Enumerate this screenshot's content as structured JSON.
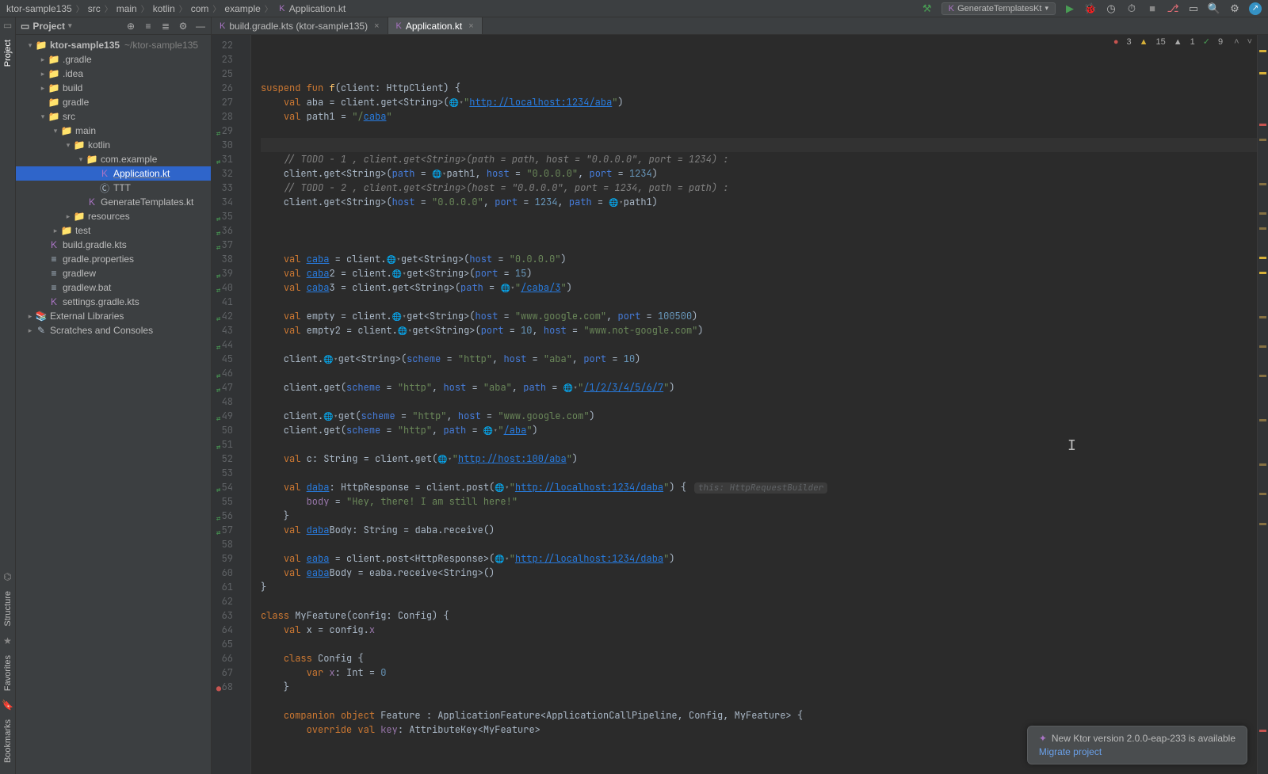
{
  "breadcrumbs": [
    "ktor-sample135",
    "src",
    "main",
    "kotlin",
    "com",
    "example",
    "Application.kt"
  ],
  "run_config": "GenerateTemplatesKt",
  "inspections": {
    "errors": "3",
    "warnings": "15",
    "weak": "1",
    "typos": "9"
  },
  "project_header": {
    "label": "Project"
  },
  "tree": [
    {
      "depth": 0,
      "arrow": "▾",
      "icon": "📁",
      "iconClass": "folder-c",
      "label": "ktor-sample135",
      "suffix": "~/ktor-sample135",
      "bold": true
    },
    {
      "depth": 1,
      "arrow": "▸",
      "icon": "📁",
      "iconClass": "orange-folder",
      "label": ".gradle"
    },
    {
      "depth": 1,
      "arrow": "▸",
      "icon": "📁",
      "iconClass": "orange-folder",
      "label": ".idea"
    },
    {
      "depth": 1,
      "arrow": "▸",
      "icon": "📁",
      "iconClass": "orange-folder",
      "label": "build"
    },
    {
      "depth": 1,
      "arrow": "",
      "icon": "📁",
      "iconClass": "folder-c",
      "label": "gradle"
    },
    {
      "depth": 1,
      "arrow": "▾",
      "icon": "📁",
      "iconClass": "blue-folder",
      "label": "src"
    },
    {
      "depth": 2,
      "arrow": "▾",
      "icon": "📁",
      "iconClass": "blue-folder",
      "label": "main"
    },
    {
      "depth": 3,
      "arrow": "▾",
      "icon": "📁",
      "iconClass": "blue-folder",
      "label": "kotlin"
    },
    {
      "depth": 4,
      "arrow": "▾",
      "icon": "📁",
      "iconClass": "folder-c",
      "label": "com.example"
    },
    {
      "depth": 5,
      "arrow": "",
      "icon": "K",
      "iconClass": "kt-file",
      "label": "Application.kt",
      "selected": true,
      "underline": true
    },
    {
      "depth": 5,
      "arrow": "",
      "icon": "Ⓒ",
      "iconClass": "file-c",
      "label": "TTT"
    },
    {
      "depth": 4,
      "arrow": "",
      "icon": "K",
      "iconClass": "kt-file",
      "label": "GenerateTemplates.kt"
    },
    {
      "depth": 3,
      "arrow": "▸",
      "icon": "📁",
      "iconClass": "folder-c",
      "label": "resources"
    },
    {
      "depth": 2,
      "arrow": "▸",
      "icon": "📁",
      "iconClass": "folder-c",
      "label": "test"
    },
    {
      "depth": 1,
      "arrow": "",
      "icon": "K",
      "iconClass": "kt-file",
      "label": "build.gradle.kts"
    },
    {
      "depth": 1,
      "arrow": "",
      "icon": "≡",
      "iconClass": "file-c",
      "label": "gradle.properties"
    },
    {
      "depth": 1,
      "arrow": "",
      "icon": "≡",
      "iconClass": "file-c",
      "label": "gradlew"
    },
    {
      "depth": 1,
      "arrow": "",
      "icon": "≡",
      "iconClass": "file-c",
      "label": "gradlew.bat"
    },
    {
      "depth": 1,
      "arrow": "",
      "icon": "K",
      "iconClass": "kt-file",
      "label": "settings.gradle.kts"
    },
    {
      "depth": 0,
      "arrow": "▸",
      "icon": "📚",
      "iconClass": "folder-c",
      "label": "External Libraries"
    },
    {
      "depth": 0,
      "arrow": "▸",
      "icon": "✎",
      "iconClass": "folder-c",
      "label": "Scratches and Consoles"
    }
  ],
  "tabs": [
    {
      "icon": "K",
      "label": "build.gradle.kts (ktor-sample135)",
      "active": false
    },
    {
      "icon": "K",
      "label": "Application.kt",
      "active": true
    }
  ],
  "editor": {
    "first_line": 22,
    "lines": [
      {
        "n": 22,
        "html": "<span class='kw'>suspend</span> <span class='kw'>fun</span> <span class='fn'>f</span>(client: HttpClient) {"
      },
      {
        "n": 23,
        "html": "    <span class='kw'>val</span> aba = client.get&lt;String&gt;(<span class='globe'>🌐▾</span><span class='str'>\"</span><span class='url'>http://localhost:1234/aba</span><span class='str'>\"</span>)"
      },
      {
        "n": 25,
        "html": "    <span class='kw'>val</span> path1 = <span class='str'>\"/</span><span class='url'>caba</span><span class='str'>\"</span>"
      },
      {
        "n": 26,
        "html": ""
      },
      {
        "n": 27,
        "html": "",
        "cursor": true
      },
      {
        "n": 28,
        "html": "    <span class='comment'>// TODO - 1 , client.get&lt;String&gt;(path = path, host = \"0.0.0.0\", port = 1234) :</span>"
      },
      {
        "n": 29,
        "mark": "run",
        "html": "    client.get&lt;String&gt;(<span class='named'>path</span> = <span class='globe'>🌐▾</span>path1, <span class='named'>host</span> = <span class='str'>\"0.0.0.0\"</span>, <span class='named'>port</span> = <span class='num'>1234</span>)"
      },
      {
        "n": 30,
        "html": "    <span class='comment'>// TODO - 2 , client.get&lt;String&gt;(host = \"0.0.0.0\", port = 1234, path = path) :</span>"
      },
      {
        "n": 31,
        "mark": "run",
        "html": "    client.get&lt;String&gt;(<span class='named'>host</span> = <span class='str'>\"0.0.0.0\"</span>, <span class='named'>port</span> = <span class='num'>1234</span>, <span class='named'>path</span> = <span class='globe'>🌐▾</span>path1)"
      },
      {
        "n": 32,
        "html": ""
      },
      {
        "n": 33,
        "html": ""
      },
      {
        "n": 34,
        "html": ""
      },
      {
        "n": 35,
        "mark": "run",
        "html": "    <span class='kw'>val</span> <span class='url'>caba</span> = client.<span class='globe'>🌐▾</span>get&lt;String&gt;(<span class='named'>host</span> = <span class='str'>\"0.0.0.0\"</span>)"
      },
      {
        "n": 36,
        "mark": "run",
        "html": "    <span class='kw'>val</span> <span class='url'>caba</span>2 = client.<span class='globe'>🌐▾</span>get&lt;String&gt;(<span class='named'>port</span> = <span class='num'>15</span>)"
      },
      {
        "n": 37,
        "mark": "run",
        "html": "    <span class='kw'>val</span> <span class='url'>caba</span>3 = client.get&lt;String&gt;(<span class='named'>path</span> = <span class='globe'>🌐▾</span><span class='str'>\"</span><span class='url'>/caba/3</span><span class='str'>\"</span>)"
      },
      {
        "n": 38,
        "html": ""
      },
      {
        "n": 39,
        "mark": "run",
        "html": "    <span class='kw'>val</span> empty = client.<span class='globe'>🌐▾</span>get&lt;String&gt;(<span class='named'>host</span> = <span class='str'>\"www.google.com\"</span>, <span class='named'>port</span> = <span class='num'>100500</span>)"
      },
      {
        "n": 40,
        "mark": "run",
        "html": "    <span class='kw'>val</span> empty2 = client.<span class='globe'>🌐▾</span>get&lt;String&gt;(<span class='named'>port</span> = <span class='num'>10</span>, <span class='named'>host</span> = <span class='str'>\"www.not-google.com\"</span>)"
      },
      {
        "n": 41,
        "html": ""
      },
      {
        "n": 42,
        "mark": "run",
        "html": "    client.<span class='globe'>🌐▾</span>get&lt;String&gt;(<span class='named'>scheme</span> = <span class='str'>\"http\"</span>, <span class='named'>host</span> = <span class='str'>\"aba\"</span>, <span class='named'>port</span> = <span class='num'>10</span>)"
      },
      {
        "n": 43,
        "html": ""
      },
      {
        "n": 44,
        "mark": "run",
        "html": "    client.get(<span class='named'>scheme</span> = <span class='str'>\"http\"</span>, <span class='named'>host</span> = <span class='str'>\"aba\"</span>, <span class='named'>path</span> = <span class='globe'>🌐▾</span><span class='str'>\"</span><span class='url'>/1/2/3/4/5/6/7</span><span class='str'>\"</span>)"
      },
      {
        "n": 45,
        "html": ""
      },
      {
        "n": 46,
        "mark": "run",
        "html": "    client.<span class='globe'>🌐▾</span>get(<span class='named'>scheme</span> = <span class='str'>\"http\"</span>, <span class='named'>host</span> = <span class='str'>\"www.google.com\"</span>)"
      },
      {
        "n": 47,
        "mark": "run",
        "html": "    client.get(<span class='named'>scheme</span> = <span class='str'>\"http\"</span>, <span class='named'>path</span> = <span class='globe'>🌐▾</span><span class='str'>\"</span><span class='url'>/aba</span><span class='str'>\"</span>)"
      },
      {
        "n": 48,
        "html": ""
      },
      {
        "n": 49,
        "mark": "run",
        "html": "    <span class='kw'>val</span> c: String = client.get(<span class='globe'>🌐▾</span><span class='str'>\"</span><span class='url'>http://host:100/aba</span><span class='str'>\"</span>)"
      },
      {
        "n": 50,
        "html": ""
      },
      {
        "n": 51,
        "mark": "run",
        "html": "    <span class='kw'>val</span> <span class='url'>daba</span>: HttpResponse = client.post(<span class='globe'>🌐▾</span><span class='str'>\"</span><span class='url'>http://localhost:1234/daba</span><span class='str'>\"</span>) {<span class='hint'>this: HttpRequestBuilder</span>"
      },
      {
        "n": 52,
        "html": "        <span class='prop'>body</span> = <span class='str'>\"Hey, there! I am still here!\"</span>"
      },
      {
        "n": 53,
        "html": "    }"
      },
      {
        "n": 54,
        "mark": "run",
        "html": "    <span class='kw'>val</span> <span class='url'>daba</span>Body: String = daba.receive()"
      },
      {
        "n": 55,
        "html": ""
      },
      {
        "n": 56,
        "mark": "run",
        "html": "    <span class='kw'>val</span> <span class='url'>eaba</span> = client.post&lt;HttpResponse&gt;(<span class='globe'>🌐▾</span><span class='str'>\"</span><span class='url'>http://localhost:1234/daba</span><span class='str'>\"</span>)"
      },
      {
        "n": 57,
        "mark": "run",
        "html": "    <span class='kw'>val</span> <span class='url'>eaba</span>Body = eaba.receive&lt;String&gt;()"
      },
      {
        "n": 58,
        "html": "}"
      },
      {
        "n": 59,
        "html": ""
      },
      {
        "n": 60,
        "html": "<span class='kw'>class</span> MyFeature(config: Config) {"
      },
      {
        "n": 61,
        "html": "    <span class='kw'>val</span> x = config.<span class='prop'>x</span>"
      },
      {
        "n": 62,
        "html": ""
      },
      {
        "n": 63,
        "html": "    <span class='kw'>class</span> Config {"
      },
      {
        "n": 64,
        "html": "        <span class='kw'>var</span> <span class='prop'>x</span>: Int = <span class='num'>0</span>"
      },
      {
        "n": 65,
        "html": "    }"
      },
      {
        "n": 66,
        "html": ""
      },
      {
        "n": 67,
        "html": "    <span class='kw'>companion</span> <span class='kw'>object</span> Feature : ApplicationFeature&lt;ApplicationCallPipeline, Config, MyFeature&gt; {"
      },
      {
        "n": 68,
        "mark": "err",
        "html": "        <span class='kw'>override</span> <span class='kw'>val</span> <span class='prop'>key</span>: AttributeKey&lt;MyFeature&gt;"
      }
    ]
  },
  "left_tools": {
    "top": [
      "Project"
    ],
    "bottom": [
      "Structure",
      "Favorites",
      "Bookmarks"
    ]
  },
  "notification": {
    "title": "New Ktor version 2.0.0-eap-233 is available",
    "link": "Migrate project"
  }
}
